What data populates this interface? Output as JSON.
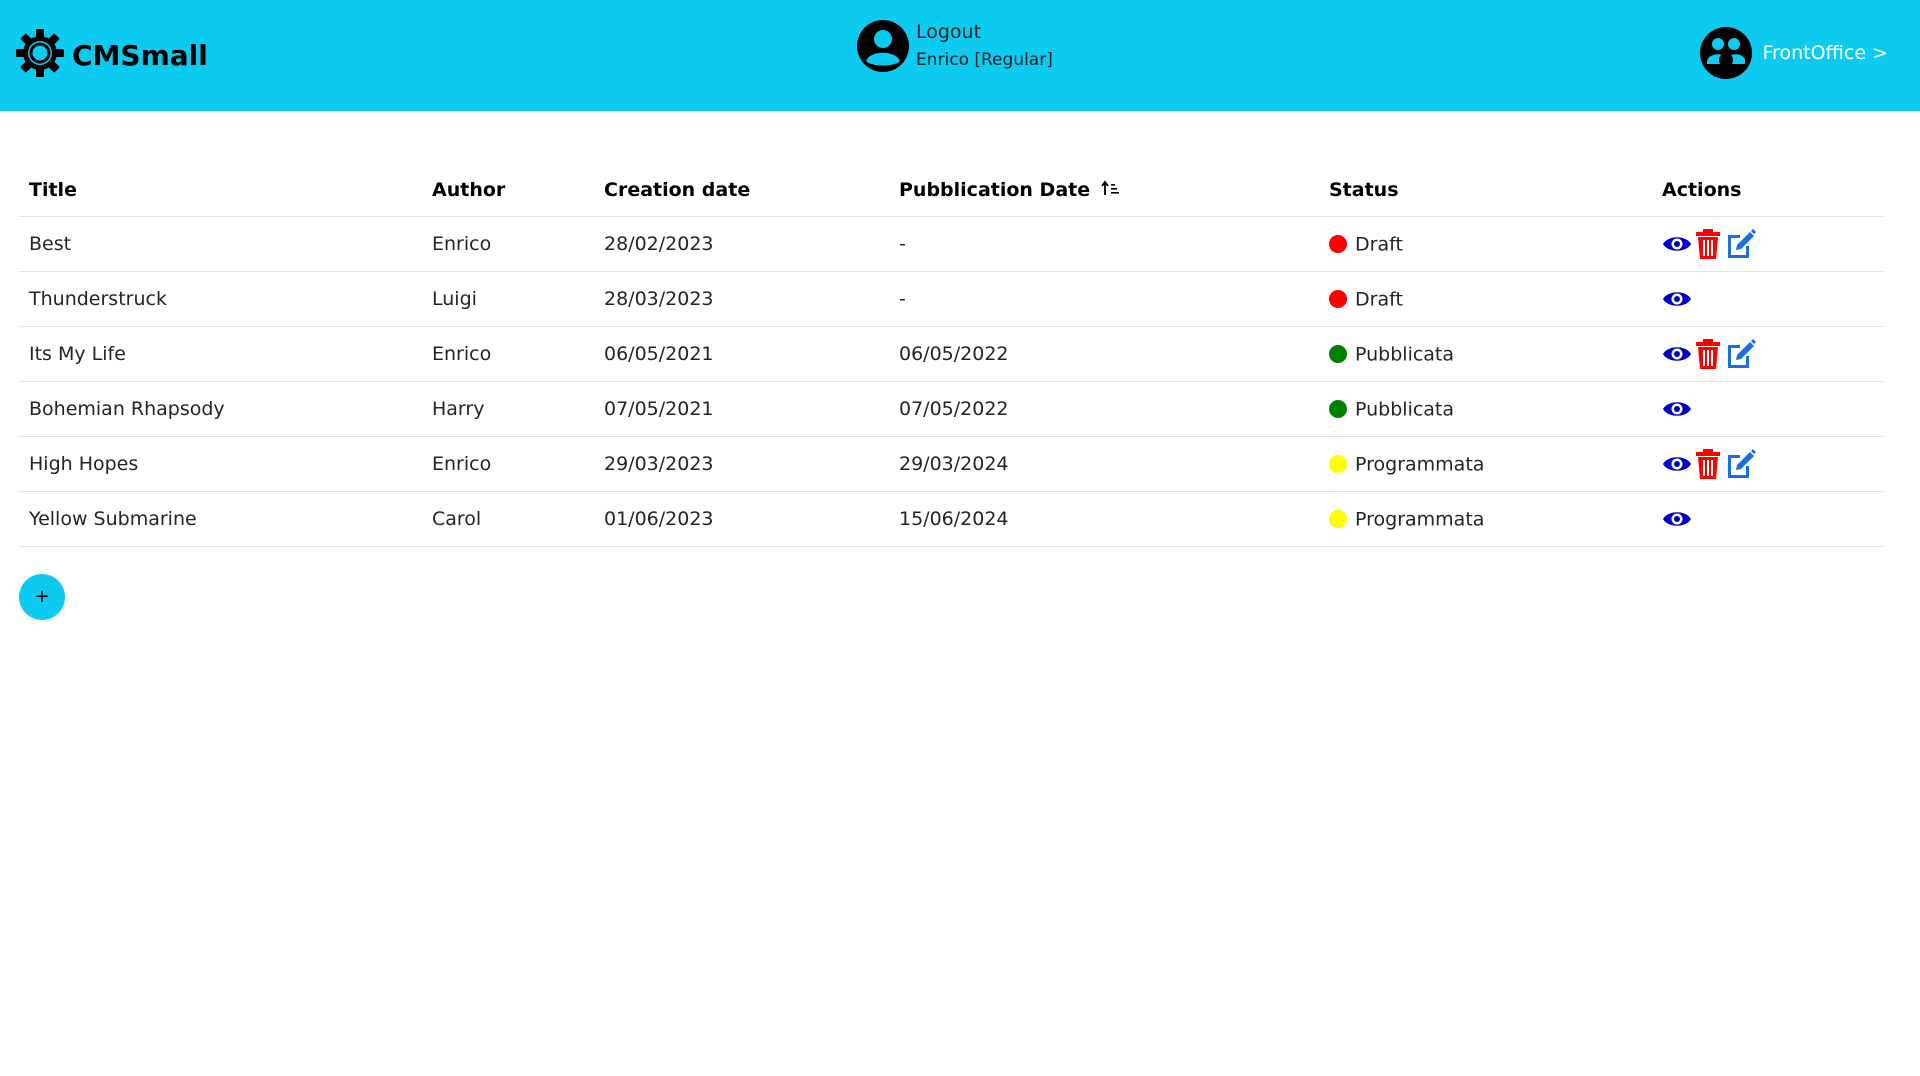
{
  "navbar": {
    "brand": "CMSmall",
    "logout_label": "Logout",
    "user_label": "Enrico [Regular]",
    "frontoffice_label": "FrontOffice >"
  },
  "table": {
    "headers": {
      "title": "Title",
      "author": "Author",
      "creation_date": "Creation date",
      "publication_date": "Pubblication Date",
      "status": "Status",
      "actions": "Actions"
    },
    "rows": [
      {
        "title": "Best",
        "author": "Enrico",
        "creation_date": "28/02/2023",
        "publication_date": "-",
        "status": "Draft",
        "status_color": "#ff0000",
        "can_edit": true
      },
      {
        "title": "Thunderstruck",
        "author": "Luigi",
        "creation_date": "28/03/2023",
        "publication_date": "-",
        "status": "Draft",
        "status_color": "#ff0000",
        "can_edit": false
      },
      {
        "title": "Its My Life",
        "author": "Enrico",
        "creation_date": "06/05/2021",
        "publication_date": "06/05/2022",
        "status": "Pubblicata",
        "status_color": "#008000",
        "can_edit": true
      },
      {
        "title": "Bohemian Rhapsody",
        "author": "Harry",
        "creation_date": "07/05/2021",
        "publication_date": "07/05/2022",
        "status": "Pubblicata",
        "status_color": "#008000",
        "can_edit": false
      },
      {
        "title": "High Hopes",
        "author": "Enrico",
        "creation_date": "29/03/2023",
        "publication_date": "29/03/2024",
        "status": "Programmata",
        "status_color": "#ffff00",
        "can_edit": true
      },
      {
        "title": "Yellow Submarine",
        "author": "Carol",
        "creation_date": "01/06/2023",
        "publication_date": "15/06/2024",
        "status": "Programmata",
        "status_color": "#ffff00",
        "can_edit": false
      }
    ]
  },
  "add_button_label": "+",
  "colors": {
    "navbar": "#0dcaf0",
    "view_icon": "#0000cc",
    "delete_icon": "#ff0000",
    "edit_icon": "#1a6fe0"
  },
  "icons": {
    "brand": "gear-icon",
    "user": "user-circle-icon",
    "frontoffice": "people-circle-icon",
    "sort": "sort-ascending-icon",
    "view": "eye-icon",
    "delete": "trash-icon",
    "edit": "edit-icon"
  }
}
